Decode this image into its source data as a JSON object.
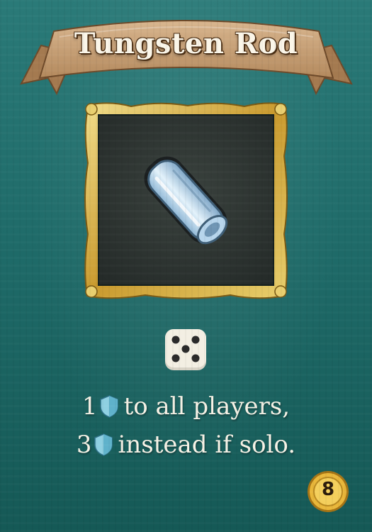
{
  "card": {
    "title": "Tungsten Rod",
    "item_icon": "tungsten-rod-icon",
    "dice_icon": "dice-five-icon",
    "effect_line_1": {
      "amount": "1",
      "icon": "shield-icon",
      "text": "to all players,"
    },
    "effect_line_2": {
      "amount": "3",
      "icon": "shield-icon",
      "text": "instead if solo."
    },
    "cost": "8"
  },
  "colors": {
    "background": "#1f6b69",
    "banner": "#c9a27a",
    "frame_gold": "#d8b545",
    "panel": "#2f3633",
    "rod": "#bcd9ef",
    "shield": "#8fd0e2",
    "coin": "#e9b73a"
  }
}
